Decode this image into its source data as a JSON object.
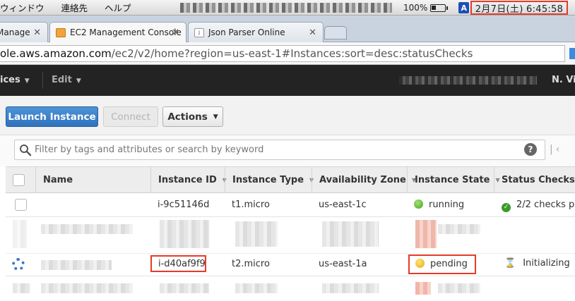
{
  "menubar": {
    "items": [
      "ウィンドウ",
      "連絡先",
      "ヘルプ"
    ],
    "battery_percent": "100%",
    "input_mode": "A",
    "clock": "2月7日(土)  6:45:58"
  },
  "tabs": [
    {
      "label": "Manage",
      "active": false
    },
    {
      "label": "EC2 Management Console",
      "active": true
    },
    {
      "label": "Json Parser Online",
      "active": false
    }
  ],
  "address": {
    "host": "ole.aws.amazon.com",
    "path": "/ec2/v2/home?region=us-east-1#Instances:sort=desc:statusChecks"
  },
  "nav": {
    "services_label": "ices",
    "edit_label": "Edit",
    "region_label": "N. Vir"
  },
  "actions": {
    "launch": "Launch Instance",
    "connect": "Connect",
    "actions": "Actions"
  },
  "filter": {
    "placeholder": "Filter by tags and attributes or search by keyword",
    "help": "?"
  },
  "table": {
    "headers": [
      "Name",
      "Instance ID",
      "Instance Type",
      "Availability Zone",
      "Instance State",
      "Status Checks"
    ],
    "rows": [
      {
        "name": "",
        "id": "i-9c51146d",
        "type": "t1.micro",
        "zone": "us-east-1c",
        "state": "running",
        "state_color": "#49a11e",
        "status": "2/2 checks pa"
      },
      {
        "name": "",
        "id": "i-d40af9f9",
        "type": "t2.micro",
        "zone": "us-east-1a",
        "state": "pending",
        "state_color": "#e5ad0c",
        "status": "Initializing"
      }
    ]
  },
  "colors": {
    "highlight": "#e53b2a",
    "primary_button": "#2f72be",
    "nav_bg": "#232323"
  }
}
